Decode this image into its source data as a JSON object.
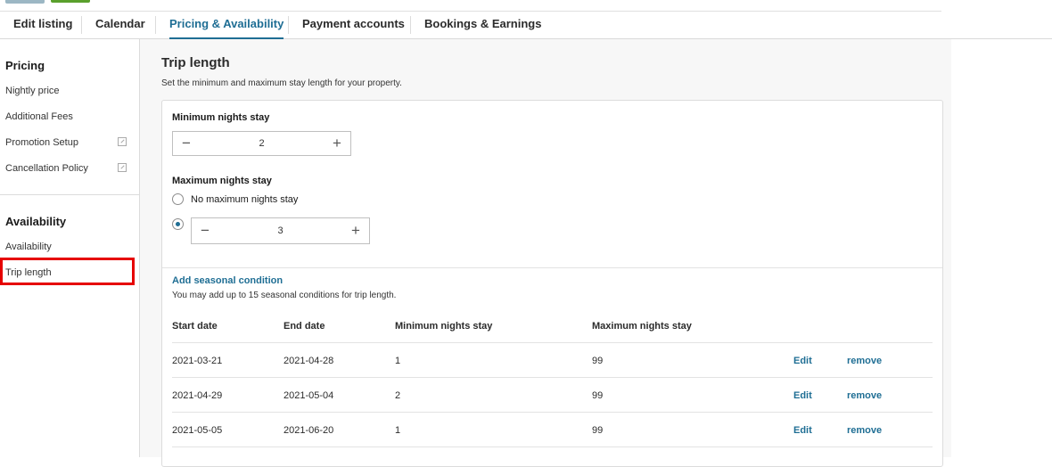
{
  "tabs": [
    {
      "label": "Edit listing",
      "active": false
    },
    {
      "label": "Calendar",
      "active": false
    },
    {
      "label": "Pricing & Availability",
      "active": true
    },
    {
      "label": "Payment accounts",
      "active": false
    },
    {
      "label": "Bookings & Earnings",
      "active": false
    }
  ],
  "sidebar": {
    "pricing_heading": "Pricing",
    "pricing_items": [
      "Nightly price",
      "Additional Fees",
      "Promotion Setup",
      "Cancellation Policy"
    ],
    "availability_heading": "Availability",
    "availability_items": [
      "Availability",
      "Trip length"
    ],
    "active_item": "Trip length",
    "accent_color": "#e60000"
  },
  "main": {
    "title": "Trip length",
    "subtitle": "Set the minimum and maximum stay length for your property.",
    "min_label": "Minimum nights stay",
    "min_value": "2",
    "max_label": "Maximum nights stay",
    "max_options": {
      "none_label": "No maximum nights stay",
      "selected": "custom"
    },
    "max_value": "3",
    "seasonal": {
      "add_link": "Add seasonal condition",
      "note": "You may add up to 15 seasonal conditions for trip length.",
      "columns": [
        "Start date",
        "End date",
        "Minimum nights stay",
        "Maximum nights stay"
      ],
      "rows": [
        {
          "start": "2021-03-21",
          "end": "2021-04-28",
          "min": "1",
          "max": "99",
          "edit": "Edit",
          "remove": "remove"
        },
        {
          "start": "2021-04-29",
          "end": "2021-05-04",
          "min": "2",
          "max": "99",
          "edit": "Edit",
          "remove": "remove"
        },
        {
          "start": "2021-05-05",
          "end": "2021-06-20",
          "min": "1",
          "max": "99",
          "edit": "Edit",
          "remove": "remove"
        }
      ]
    },
    "link_color": "#1f6e94"
  },
  "icons": {
    "minus": "minus-icon",
    "plus": "plus-icon",
    "external": "external-link-icon"
  }
}
